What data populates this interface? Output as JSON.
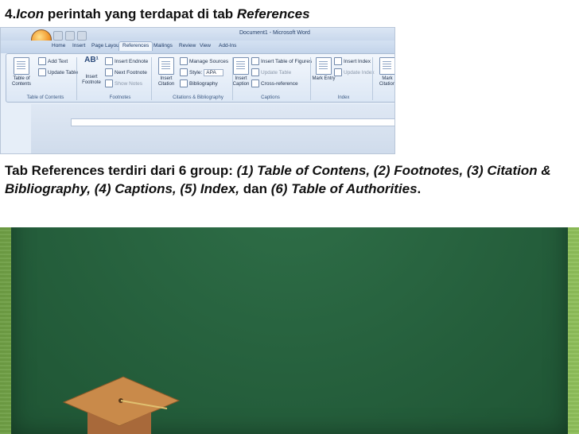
{
  "slide": {
    "title_num": "4.",
    "title_italic": "Icon",
    "title_mid": " perintah yang terdapat di tab ",
    "title_end": "References"
  },
  "ribbon": {
    "window_title": "Document1 - Microsoft Word",
    "tabs": [
      "Home",
      "Insert",
      "Page Layout",
      "References",
      "Mailings",
      "Review",
      "View",
      "Add-Ins"
    ],
    "active_tab": "References",
    "groups": {
      "toc": {
        "label": "Table of Contents",
        "big": "Table of Contents",
        "add_text": "Add Text",
        "update_table": "Update Table"
      },
      "footnotes": {
        "label": "Footnotes",
        "big": "Insert Footnote",
        "insert_endnote": "Insert Endnote",
        "next_footnote": "Next Footnote",
        "show_notes": "Show Notes",
        "ab_glyph": "AB¹"
      },
      "citations": {
        "label": "Citations & Bibliography",
        "big": "Insert Citation",
        "manage_sources": "Manage Sources",
        "style_label": "Style:",
        "style_value": "APA",
        "bibliography": "Bibliography"
      },
      "captions": {
        "label": "Captions",
        "big": "Insert Caption",
        "insert_table_figures": "Insert Table of Figures",
        "update_table": "Update Table",
        "cross_reference": "Cross-reference"
      },
      "index": {
        "label": "Index",
        "big": "Mark Entry",
        "insert_index": "Insert Index",
        "update_index": "Update Index"
      },
      "authorities": {
        "big": "Mark Citation"
      }
    }
  },
  "body": {
    "p1": "Tab References terdiri dari 6 group: ",
    "g1": "(1) Table of Contens, (2) Footnotes, (3) Citation & Bibliography, (4) Captions, (5) Index,",
    "p2": " dan ",
    "g2": "(6) Table of Authorities",
    "p3": "."
  },
  "colors": {
    "board": "#255f3c",
    "frame": "#8cbc58",
    "cap": "#c98a4a"
  }
}
